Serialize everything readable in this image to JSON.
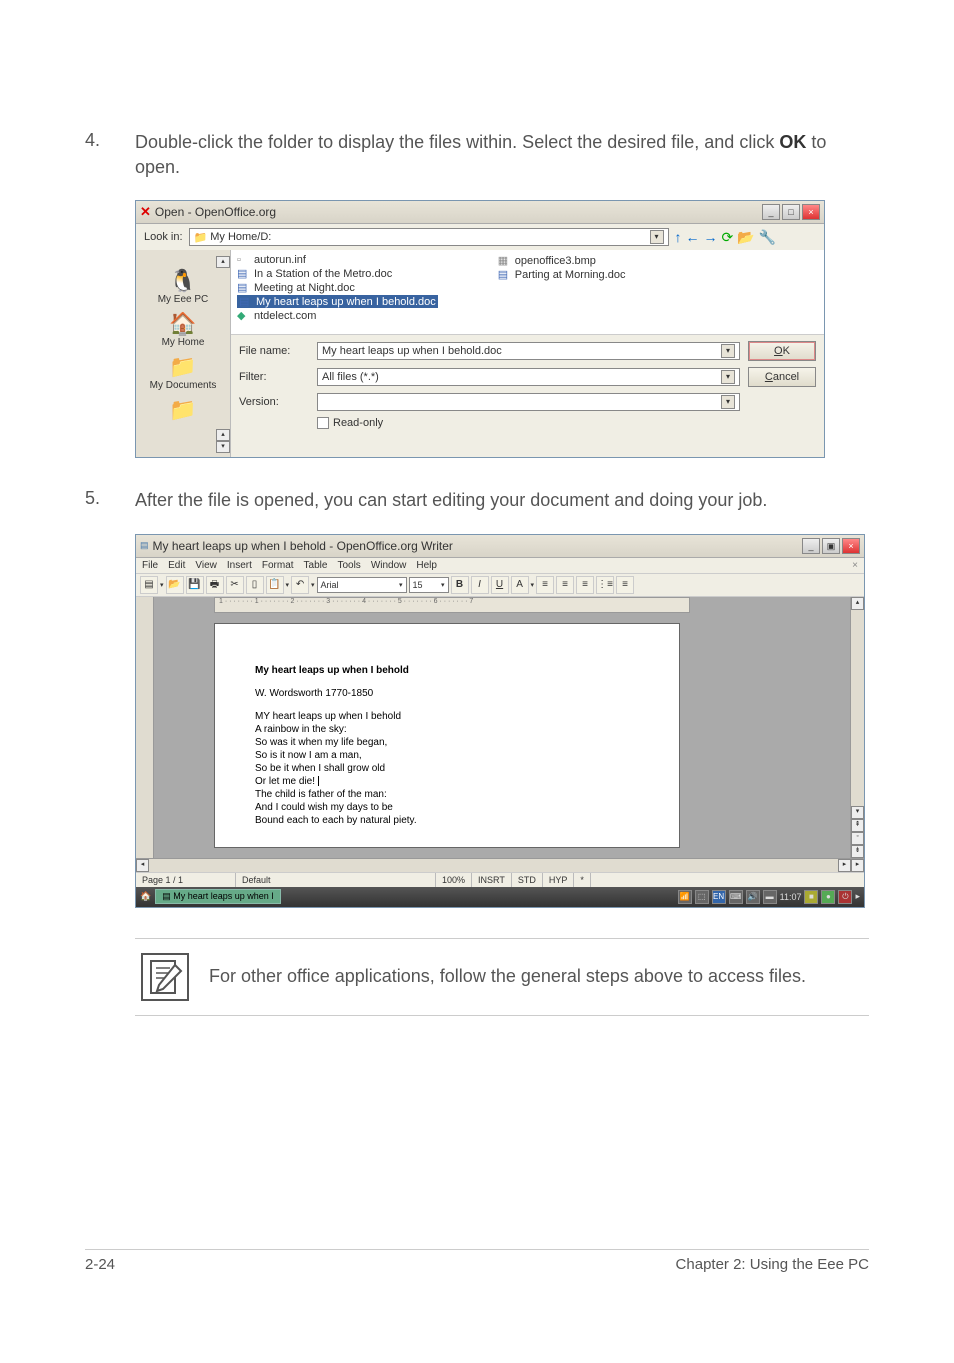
{
  "step4": {
    "num": "4.",
    "text_a": "Double-click the folder to display the files within. Select the desired file, and click ",
    "text_b": "OK",
    "text_c": " to open."
  },
  "step5": {
    "num": "5.",
    "text": "After the file is opened, you can start editing your document and doing your job."
  },
  "dialog1": {
    "title": "Open - OpenOffice.org",
    "lookin_label": "Look in:",
    "lookin_value": "My Home/D:",
    "places": {
      "eee": "My Eee PC",
      "home": "My Home",
      "docs": "My Documents"
    },
    "files_col1": [
      "autorun.inf",
      "In a Station of the Metro.doc",
      "Meeting at Night.doc",
      "My heart leaps up when I behold.doc",
      "ntdelect.com"
    ],
    "files_col2": [
      "openoffice3.bmp",
      "Parting at Morning.doc"
    ],
    "filename_label": "File name:",
    "filename_value": "My heart leaps up when I behold.doc",
    "filter_label": "Filter:",
    "filter_value": "All files (*.*)",
    "version_label": "Version:",
    "readonly_label": "Read-only",
    "ok_label": "OK",
    "cancel_label": "Cancel"
  },
  "dialog2": {
    "title": "My heart leaps up when I behold - OpenOffice.org Writer",
    "menu": [
      "File",
      "Edit",
      "View",
      "Insert",
      "Format",
      "Table",
      "Tools",
      "Window",
      "Help"
    ],
    "font_name": "Arial",
    "font_size": "15",
    "ruler": "1 · · · · · · · 1 · · · · · · · 2 · · · · · · · 3 · · · · · · · 4 · · · · · · · 5 · · · · · · · 6 · · · · · · · 7",
    "doc_title": "My heart leaps up when I behold",
    "doc_author": "W. Wordsworth 1770-1850",
    "doc_lines": [
      "MY heart leaps up when I behold",
      "A rainbow in the sky:",
      "So was it when my life began,",
      "So is it now I am a man,",
      "So be it when I shall grow old",
      "Or let me die!",
      "The child is father of the man:",
      "And I could wish my days to be",
      "Bound each to each by natural piety."
    ],
    "status": {
      "page": "Page 1 / 1",
      "style": "Default",
      "zoom": "100%",
      "insrt": "INSRT",
      "std": "STD",
      "hyp": "HYP"
    },
    "taskbar_title": "My heart leaps up when I",
    "clock": "11:07"
  },
  "note": "For other office applications, follow the general steps above to access files.",
  "footer": {
    "page": "2-24",
    "chapter": "Chapter 2: Using the Eee PC"
  }
}
